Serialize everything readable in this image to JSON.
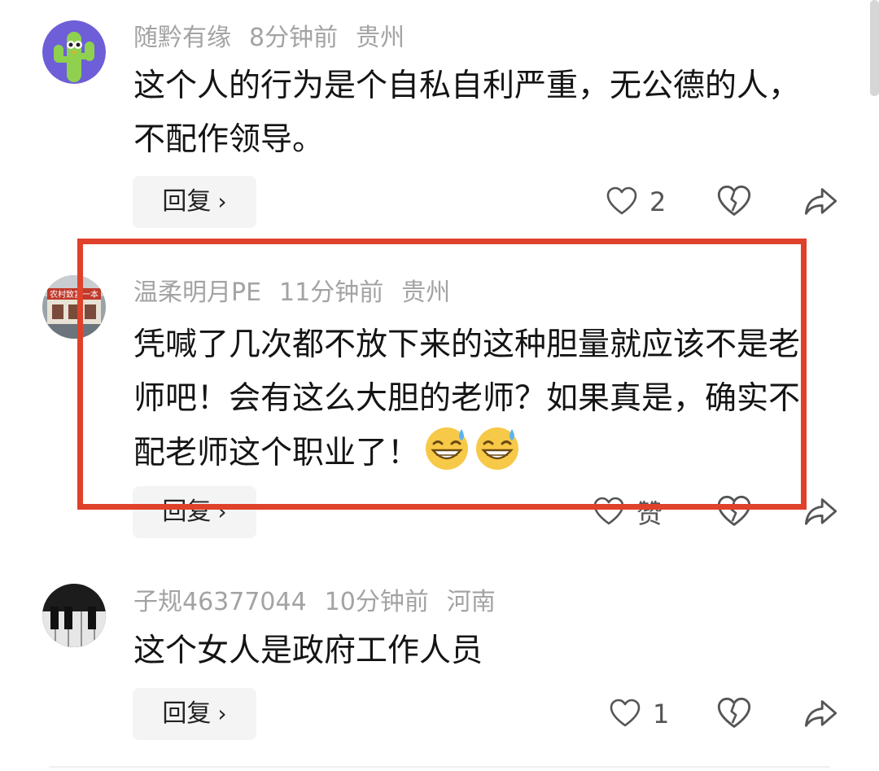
{
  "comments": [
    {
      "username": "随黔有缘",
      "time": "8分钟前",
      "location": "贵州",
      "text": "这个人的行为是个自私自利严重，无公德的人，不配作领导。",
      "reply_label": "回复",
      "like_count": "2"
    },
    {
      "username": "温柔明月PE",
      "time": "11分钟前",
      "location": "贵州",
      "text": "凭喊了几次都不放下来的这种胆量就应该不是老师吧！会有这么大胆的老师？如果真是，确实不配老师这个职业了！",
      "reply_label": "回复",
      "like_label": "赞",
      "avatar_sign": "农村致富一本"
    },
    {
      "username": "子规46377044",
      "time": "10分钟前",
      "location": "河南",
      "text": "这个女人是政府工作人员",
      "reply_label": "回复",
      "like_count": "1"
    }
  ],
  "colors": {
    "highlight_border": "#e0412b",
    "meta_text": "#a3a3a3",
    "reply_bg": "#f4f4f4"
  },
  "icons": [
    "heart-icon",
    "broken-heart-icon",
    "share-arrow-icon",
    "chevron-right-icon",
    "grin-sweat-emoji"
  ]
}
